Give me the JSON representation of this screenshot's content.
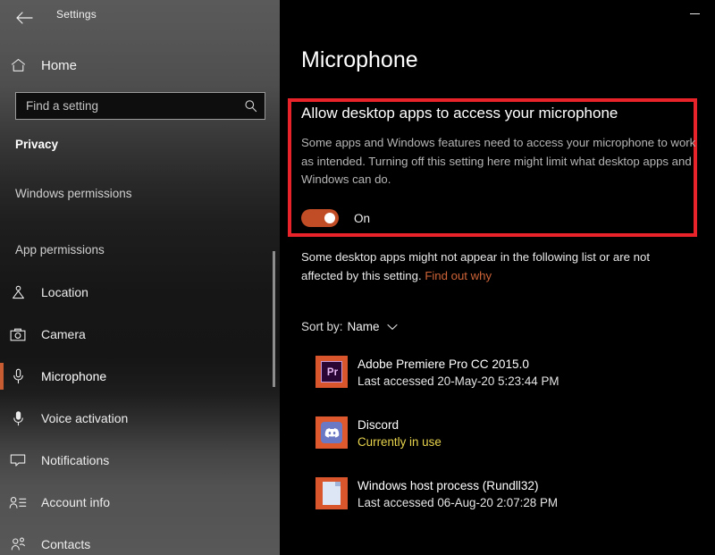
{
  "window": {
    "app_title": "Settings",
    "back_icon": "back-arrow-icon",
    "minimize_icon": "minimize-icon"
  },
  "sidebar": {
    "home": {
      "label": "Home",
      "icon": "home-icon"
    },
    "search": {
      "value": "",
      "placeholder": "Find a setting",
      "icon": "search-icon"
    },
    "category": "Privacy",
    "sections": [
      {
        "heading": "Windows permissions"
      },
      {
        "heading": "App permissions"
      }
    ],
    "items": [
      {
        "label": "Location",
        "icon": "location-pin-icon",
        "selected": false
      },
      {
        "label": "Camera",
        "icon": "camera-icon",
        "selected": false
      },
      {
        "label": "Microphone",
        "icon": "microphone-icon",
        "selected": true
      },
      {
        "label": "Voice activation",
        "icon": "voice-activation-icon",
        "selected": false
      },
      {
        "label": "Notifications",
        "icon": "notification-bubble-icon",
        "selected": false
      },
      {
        "label": "Account info",
        "icon": "account-info-icon",
        "selected": false
      },
      {
        "label": "Contacts",
        "icon": "contacts-icon",
        "selected": false
      }
    ]
  },
  "main": {
    "page_title": "Microphone",
    "allow_section": {
      "heading": "Allow desktop apps to access your microphone",
      "description": "Some apps and Windows features need to access your microphone to work as intended. Turning off this setting here might limit what desktop apps and Windows can do.",
      "toggle_state": "On",
      "toggle_on": true
    },
    "note": {
      "text": "Some desktop apps might not appear in the following list or are not affected by this setting. ",
      "link_label": "Find out why"
    },
    "sort": {
      "label": "Sort by:",
      "value": "Name",
      "caret_icon": "chevron-down-icon"
    },
    "apps": [
      {
        "name": "Adobe Premiere Pro CC 2015.0",
        "status": "Last accessed 20-May-20 5:23:44 PM",
        "in_use": false,
        "icon": "premiere-pro-icon",
        "icon_glyph": "Pr"
      },
      {
        "name": "Discord",
        "status": "Currently in use",
        "in_use": true,
        "icon": "discord-icon"
      },
      {
        "name": "Windows host process (Rundll32)",
        "status": "Last accessed 06-Aug-20 2:07:28 PM",
        "in_use": false,
        "icon": "document-icon"
      }
    ]
  },
  "colors": {
    "accent": "#C14D26",
    "highlight_border": "#E8232A",
    "link": "#CF6438",
    "in_use": "#E8D44D",
    "background": "#000000"
  }
}
